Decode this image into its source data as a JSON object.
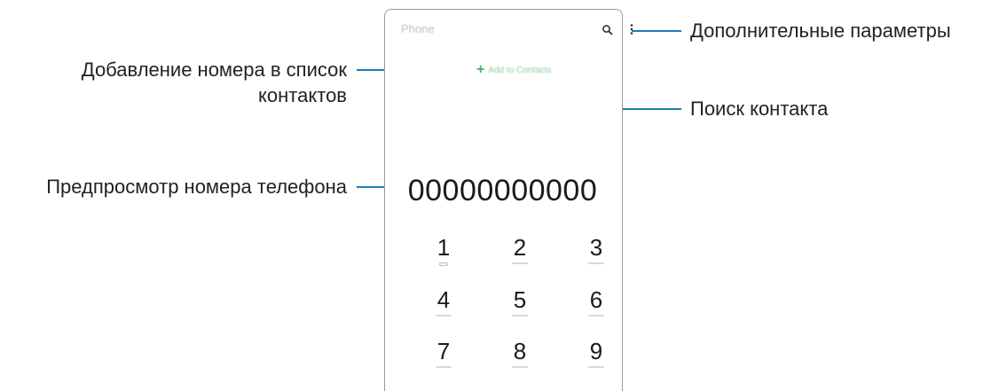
{
  "phone": {
    "app_title": "Phone",
    "add_to_contacts_label": "Add to Contacts",
    "add_icon": "plus-icon",
    "search_icon": "search-icon",
    "more_icon": "more-options-icon",
    "number_preview": "00000000000",
    "keypad": [
      {
        "digit": "1",
        "sub": "voicemail"
      },
      {
        "digit": "2",
        "sub": ""
      },
      {
        "digit": "3",
        "sub": ""
      },
      {
        "digit": "4",
        "sub": ""
      },
      {
        "digit": "5",
        "sub": ""
      },
      {
        "digit": "6",
        "sub": ""
      },
      {
        "digit": "7",
        "sub": ""
      },
      {
        "digit": "8",
        "sub": ""
      },
      {
        "digit": "9",
        "sub": ""
      }
    ]
  },
  "callouts": {
    "more_options": "Дополнительные параметры",
    "add_to_contacts_line1": "Добавление номера в список",
    "add_to_contacts_line2": "контактов",
    "search_contact": "Поиск контакта",
    "number_preview": "Предпросмотр номера телефона"
  },
  "colors": {
    "callout_line": "#1f7db8",
    "accent_green": "#46b35a"
  }
}
